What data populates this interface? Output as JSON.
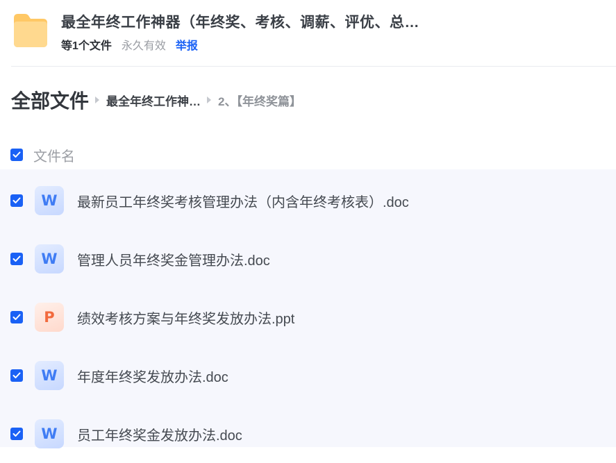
{
  "share": {
    "title": "最全年终工作神器（年终奖、考核、调薪、评优、总…",
    "file_count": "等1个文件",
    "validity": "永久有效",
    "report_label": "举报"
  },
  "breadcrumb": {
    "root": "全部文件",
    "level1": "最全年终工作神…",
    "current": "2、【年终奖篇】"
  },
  "list": {
    "header_label": "文件名",
    "files": [
      {
        "icon": "W",
        "type": "doc",
        "name": "最新员工年终奖考核管理办法（内含年终考核表）.doc"
      },
      {
        "icon": "W",
        "type": "doc",
        "name": "管理人员年终奖金管理办法.doc"
      },
      {
        "icon": "P",
        "type": "ppt",
        "name": "绩效考核方案与年终奖发放办法.ppt"
      },
      {
        "icon": "W",
        "type": "doc",
        "name": "年度年终奖发放办法.doc"
      },
      {
        "icon": "W",
        "type": "doc",
        "name": "员工年终奖金发放办法.doc"
      }
    ]
  },
  "colors": {
    "accent": "#1a61f5",
    "list_background": "#f6f7fd",
    "folder": "#ffc865",
    "doc_icon": "#3f7cf4",
    "ppt_icon": "#f26a3d"
  }
}
